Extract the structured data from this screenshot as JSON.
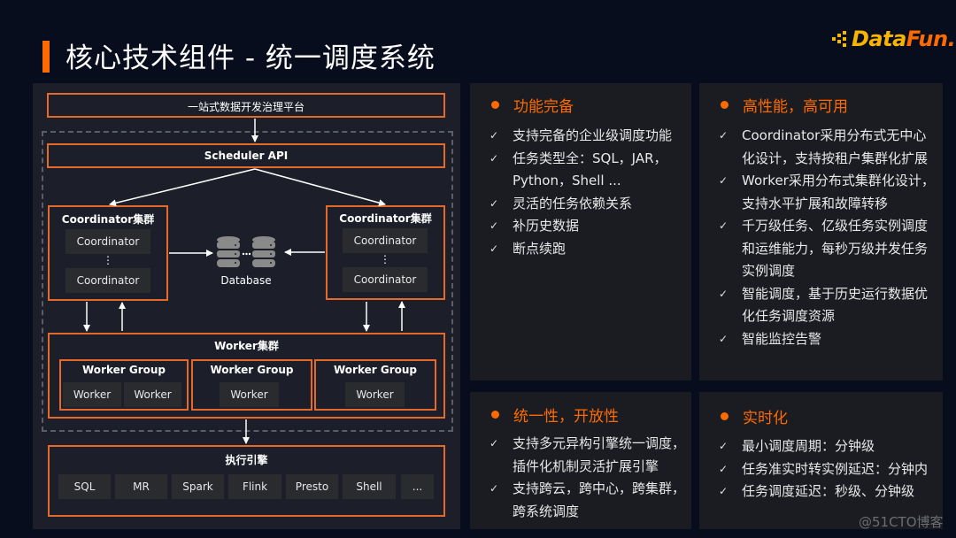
{
  "title": "核心技术组件 - 统一调度系统",
  "logo": {
    "part1": "Data",
    "part2": "Fun.",
    "accent_yellow": "#f7b500",
    "accent_orange": "#ff6a00"
  },
  "diagram": {
    "platform": "一站式数据开发治理平台",
    "scheduler_api": "Scheduler API",
    "coordinator_cluster_left": {
      "title": "Coordinator集群",
      "nodes": [
        "Coordinator",
        "Coordinator"
      ],
      "ellipsis": "⋮"
    },
    "coordinator_cluster_right": {
      "title": "Coordinator集群",
      "nodes": [
        "Coordinator",
        "Coordinator"
      ],
      "ellipsis": "⋮"
    },
    "database": {
      "label": "Database",
      "icon": "database-icon",
      "ellipsis": "···"
    },
    "worker_cluster": {
      "title": "Worker集群",
      "groups": [
        {
          "title": "Worker Group",
          "workers": [
            "Worker",
            "Worker"
          ]
        },
        {
          "title": "Worker Group",
          "workers": [
            "Worker"
          ]
        },
        {
          "title": "Worker Group",
          "workers": [
            "Worker"
          ]
        }
      ]
    },
    "engine": {
      "title": "执行引擎",
      "items": [
        "SQL",
        "MR",
        "Spark",
        "Flink",
        "Presto",
        "Shell",
        "..."
      ]
    },
    "border_color": "#e4692a"
  },
  "cards": [
    {
      "heading": "功能完备",
      "items": [
        "支持完备的企业级调度功能",
        "任务类型全：SQL，JAR，\nPython，Shell ...",
        "灵活的任务依赖关系",
        "补历史数据",
        "断点续跑"
      ]
    },
    {
      "heading": "高性能，高可用",
      "items": [
        "Coordinator采用分布式无中心\n化设计，支持按租户集群化扩展",
        "Worker采用分布式集群化设计，\n支持水平扩展和故障转移",
        "千万级任务、亿级任务实例调度\n和运维能力，每秒万级并发任务\n实例调度",
        "智能调度，基于历史运行数据优\n化任务调度资源",
        "智能监控告警"
      ]
    },
    {
      "heading": "统一性，开放性",
      "items": [
        "支持多元异构引擎统一调度，\n插件化机制灵活扩展引擎",
        "支持跨云，跨中心，跨集群，\n跨系统调度"
      ]
    },
    {
      "heading": "实时化",
      "items": [
        "最小调度周期：分钟级",
        "任务准实时转实例延迟：分钟内",
        "任务调度延迟：秒级、分钟级"
      ]
    }
  ],
  "check_glyph": "✓",
  "accent_color": "#ff6a00",
  "watermark": "@51CTO博客"
}
